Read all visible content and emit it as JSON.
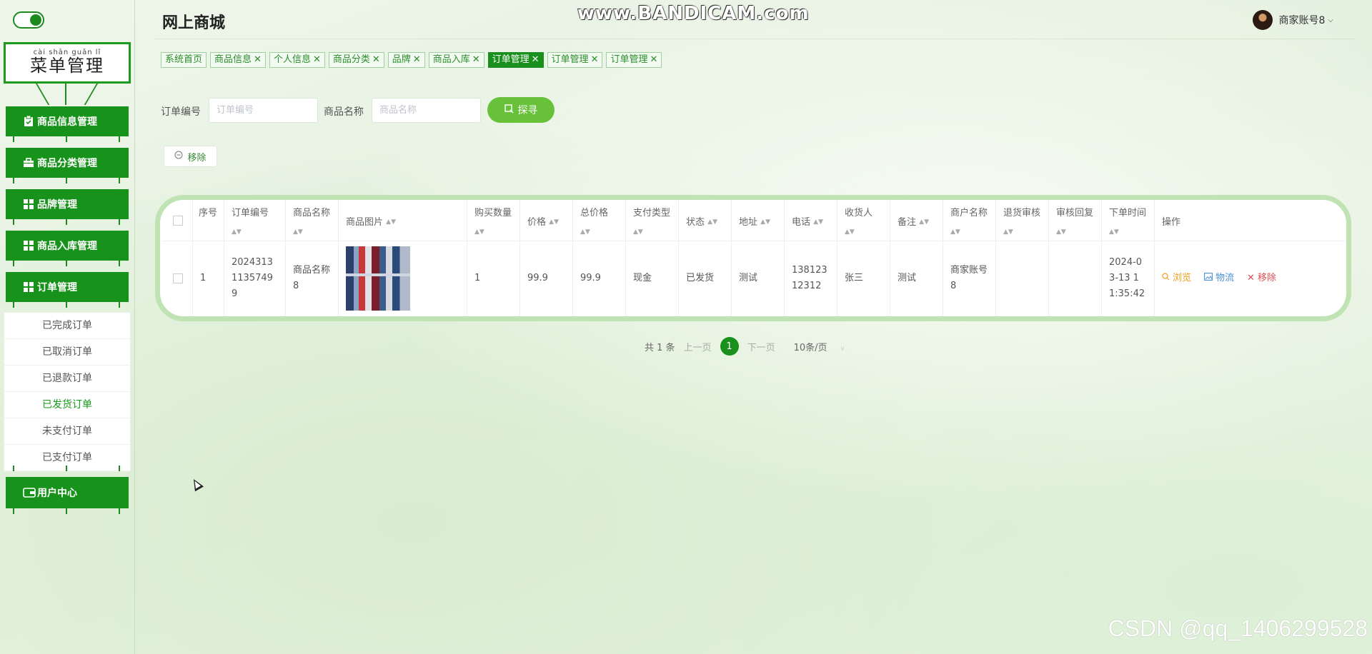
{
  "sidebar": {
    "title_pinyin": "cài shān guǎn lǐ",
    "title": "菜单管理",
    "items": [
      {
        "label": "商品信息管理",
        "icon": "clipboard-check-icon"
      },
      {
        "label": "商品分类管理",
        "icon": "briefcase-icon"
      },
      {
        "label": "品牌管理",
        "icon": "grid-icon"
      },
      {
        "label": "商品入库管理",
        "icon": "grid-icon"
      },
      {
        "label": "订单管理",
        "icon": "grid-icon"
      }
    ],
    "submenu": [
      "已完成订单",
      "已取消订单",
      "已退款订单",
      "已发货订单",
      "未支付订单",
      "已支付订单"
    ],
    "submenu_active": "已发货订单",
    "user_center": {
      "label": "用户中心",
      "icon": "wallet-icon"
    }
  },
  "header": {
    "app_title": "网上商城",
    "watermark": "www.BANDICAM.com",
    "user_name": "商家账号8"
  },
  "tabs": [
    {
      "label": "系统首页",
      "closable": false,
      "active": false
    },
    {
      "label": "商品信息",
      "closable": true,
      "active": false
    },
    {
      "label": "个人信息",
      "closable": true,
      "active": false
    },
    {
      "label": "商品分类",
      "closable": true,
      "active": false
    },
    {
      "label": "品牌",
      "closable": true,
      "active": false
    },
    {
      "label": "商品入库",
      "closable": true,
      "active": false
    },
    {
      "label": "订单管理",
      "closable": true,
      "active": true
    },
    {
      "label": "订单管理",
      "closable": true,
      "active": false
    },
    {
      "label": "订单管理",
      "closable": true,
      "active": false
    }
  ],
  "search": {
    "order_no_label": "订单编号",
    "order_no_placeholder": "订单编号",
    "product_name_label": "商品名称",
    "product_name_placeholder": "商品名称",
    "button": "探寻"
  },
  "toolbar": {
    "remove_label": "移除"
  },
  "table": {
    "headers": [
      "序号",
      "订单编号",
      "商品名称",
      "商品图片",
      "购买数量",
      "价格",
      "总价格",
      "支付类型",
      "状态",
      "地址",
      "电话",
      "收货人",
      "备注",
      "商户名称",
      "退货审核",
      "审核回复",
      "下单时间",
      "操作"
    ],
    "rows": [
      {
        "index": "1",
        "order_no": "20243131135749 9",
        "product_name": "商品名称8",
        "quantity": "1",
        "price": "99.9",
        "total": "99.9",
        "pay_type": "现金",
        "status": "已发货",
        "address": "测试",
        "phone": "13812312312",
        "receiver": "张三",
        "remark": "测试",
        "merchant": "商家账号8",
        "return_review": "",
        "review_reply": "",
        "order_time": "2024-03-13 11:35:42"
      }
    ],
    "actions": {
      "view": "浏览",
      "logistics": "物流",
      "remove": "移除"
    }
  },
  "pagination": {
    "total": "共 1 条",
    "prev": "上一页",
    "current": "1",
    "next": "下一页",
    "page_size": "10条/页"
  },
  "watermark_bottom": "CSDN @qq_1406299528",
  "colors": {
    "primary": "#18901b",
    "accent_button": "#67c23a",
    "view": "#f0a020",
    "logistics": "#4a90d6",
    "remove": "#e05050"
  }
}
